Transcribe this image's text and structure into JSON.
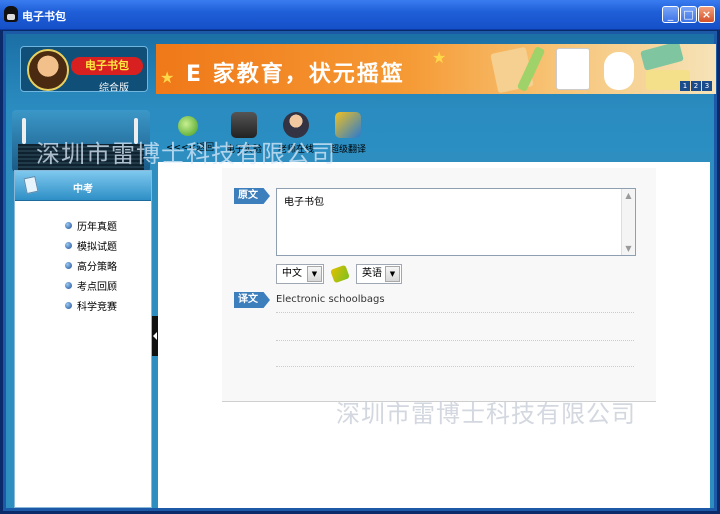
{
  "window": {
    "title": "电子书包"
  },
  "header": {
    "logo_title": "电子书包",
    "logo_subtitle": "综合版",
    "banner_text": "E 家教育，状元摇篮",
    "banner_pages": [
      "1",
      "2",
      "3"
    ]
  },
  "watermark": "深圳市雷博士科技有限公司",
  "toolbar": {
    "items": [
      {
        "label": "<<<<返回",
        "icon": "back-arrow-icon"
      },
      {
        "label": "电子实验",
        "icon": "experiment-icon"
      },
      {
        "label": "老师在线",
        "icon": "teacher-icon"
      },
      {
        "label": "超级翻译",
        "icon": "translate-icon"
      }
    ]
  },
  "sidebar": {
    "header": "中考",
    "items": [
      {
        "label": "历年真题"
      },
      {
        "label": "模拟试题"
      },
      {
        "label": "高分策略"
      },
      {
        "label": "考点回顾"
      },
      {
        "label": "科学竞赛"
      }
    ]
  },
  "translator": {
    "source_tag": "原文",
    "source_text": "电子书包",
    "from_lang": "中文",
    "to_lang": "英语",
    "target_tag": "译文",
    "target_text": "Electronic schoolbags"
  },
  "colors": {
    "titlebar": "#1f5fd8",
    "frame": "#2f8ec0",
    "banner": "#f07818",
    "tag": "#3d7ebc"
  }
}
